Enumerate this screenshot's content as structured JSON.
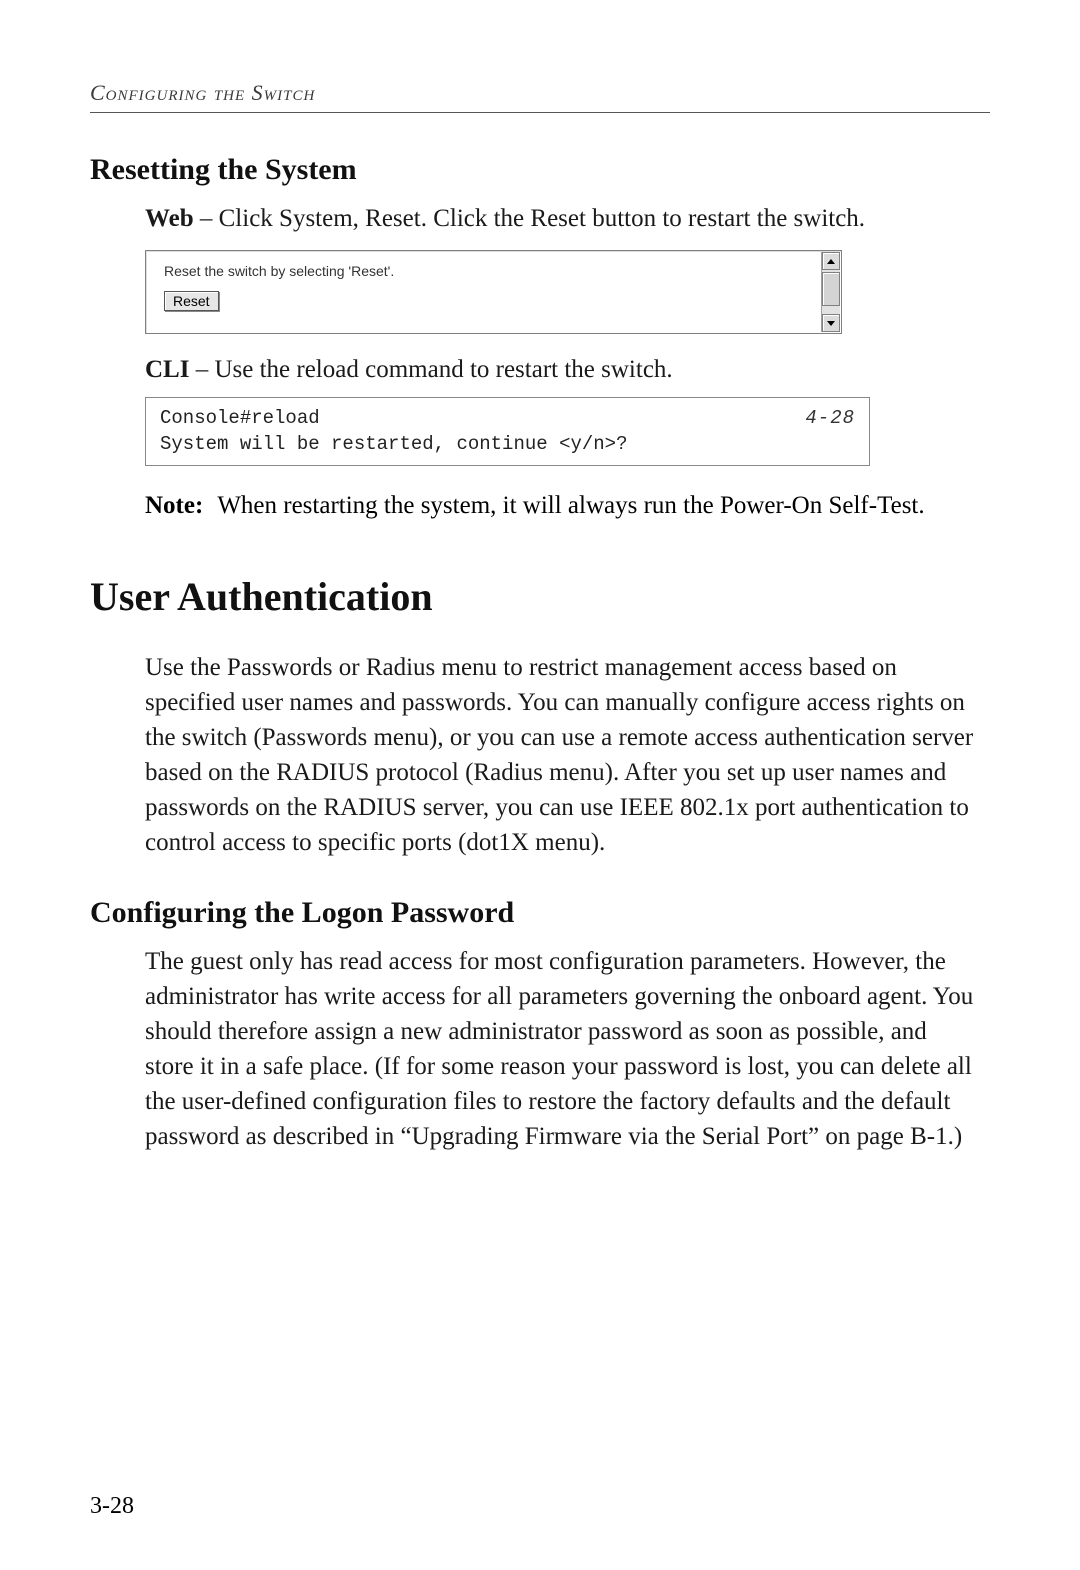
{
  "header": {
    "running_head": "Configuring the Switch"
  },
  "sections": {
    "reset": {
      "title": "Resetting the System",
      "web_prefix": "Web",
      "web_desc": " – Click System, Reset. Click the Reset button to restart the switch.",
      "panel_help": "Reset the switch by selecting 'Reset'.",
      "reset_button_label": "Reset",
      "cli_prefix": "CLI",
      "cli_desc": " – Use the reload command to restart the switch.",
      "cli_line1_left": "Console#reload",
      "cli_line1_ref": "4-28",
      "cli_line2": "System will be restarted, continue <y/n>?",
      "note_label": "Note:",
      "note_body": "When restarting the system, it will always run the Power-On Self-Test."
    },
    "userauth": {
      "title": "User Authentication",
      "intro": "Use the Passwords or Radius menu to restrict management access based on specified user names and passwords. You can manually configure access rights on the switch (Passwords menu), or you can use a remote access authentication server based on the RADIUS protocol (Radius menu). After you set up user names and passwords on the RADIUS server, you can use IEEE 802.1x port authentication to control access to specific ports (dot1X menu).",
      "logon_title": "Configuring the Logon Password",
      "logon_body": "The guest only has read access for most configuration parameters. However, the administrator has write access for all parameters governing the onboard agent. You should therefore assign a new administrator password as soon as possible, and store it in a safe place. (If for some reason your password is lost, you can delete all the user-defined configuration files to restore the factory defaults and the default password as described in “Upgrading Firmware via the Serial Port” on page B-1.)"
    }
  },
  "page_number": "3-28"
}
